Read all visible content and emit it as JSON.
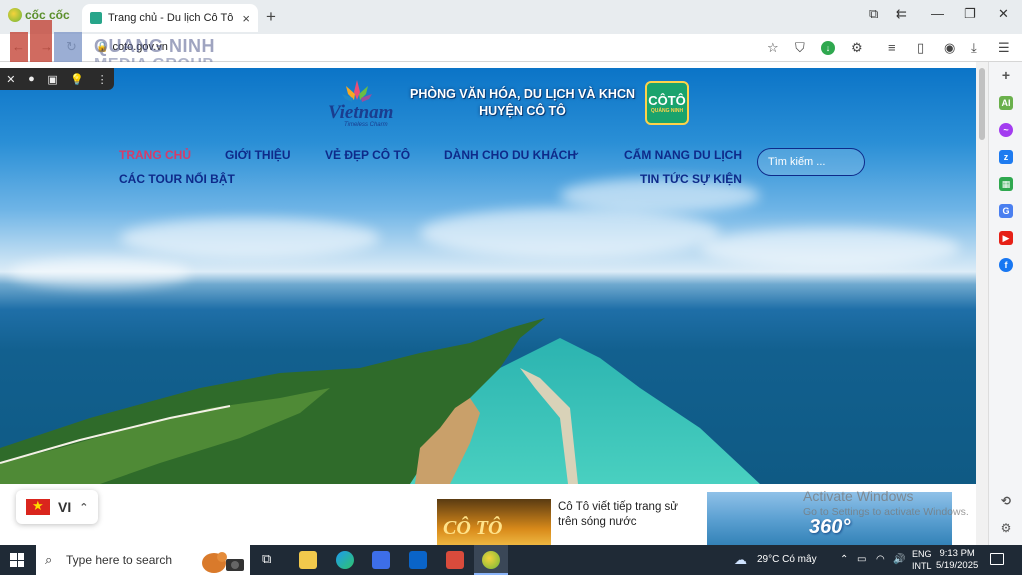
{
  "browser": {
    "brand": "cốc cốc",
    "tab_title": "Trang chủ - Du lịch Cô Tô",
    "url": "coto.gov.vn",
    "new_tab": "+",
    "close_tab": "×"
  },
  "watermark": {
    "line1": "QUANG NINH",
    "line2": "MEDIA GROUP"
  },
  "site": {
    "vn_logo_word": "Vietnam",
    "vn_logo_sub": "Timeless Charm",
    "dept_line1": "PHÒNG VĂN HÓA, DU LỊCH VÀ KHCN",
    "dept_line2": "HUYỆN CÔ TÔ",
    "badge_top": "CÔTÔ",
    "badge_bottom": "QUẢNG NINH",
    "nav": {
      "home": "TRANG CHỦ",
      "about": "GIỚI THIỆU",
      "beauty": "VẺ ĐẸP CÔ TÔ",
      "visitors": "DÀNH CHO DU KHÁCH",
      "handbook": "CẨM NANG DU LỊCH",
      "tours": "CÁC TOUR NỔI BẬT",
      "news": "TIN TỨC SỰ KIỆN"
    },
    "search_placeholder": "Tìm kiếm ...",
    "news_title": "Cô Tô viết tiếp trang sử trên sóng nước",
    "news_thumb_text": "CÔ TÔ",
    "badge_360": "360°",
    "lang_code": "VI"
  },
  "windows": {
    "activate_title": "Activate Windows",
    "activate_sub": "Go to Settings to activate Windows.",
    "search_placeholder": "Type here to search",
    "weather": "29°C  Có mây",
    "lang_line1": "ENG",
    "lang_line2": "INTL",
    "time": "9:13 PM",
    "date": "5/19/2025"
  },
  "colors": {
    "nav_text": "#0e2a8a",
    "nav_active": "#d63c6a",
    "taskbar": "#1f2a36"
  }
}
